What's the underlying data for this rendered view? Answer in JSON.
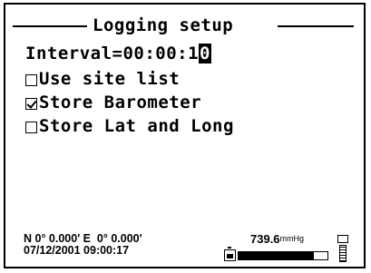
{
  "screen": {
    "title": "Logging setup",
    "interval": {
      "label": "Interval=",
      "value_prefix": "00:00:1",
      "value_cursor": "0"
    },
    "options": [
      {
        "label": "Use site list",
        "checked": false
      },
      {
        "label": "Store Barometer",
        "checked": true
      },
      {
        "label": "Store Lat and Long",
        "checked": false
      }
    ]
  },
  "status_bar": {
    "coordinates": "N 0° 0.000' E  0° 0.000'",
    "datetime": "07/12/2001 09:00:17",
    "pressure_value": "739.6",
    "pressure_unit": "mmHg",
    "battery_icon": "battery-icon",
    "level_fraction": 0.85,
    "probe_icon": "probe-icon"
  }
}
